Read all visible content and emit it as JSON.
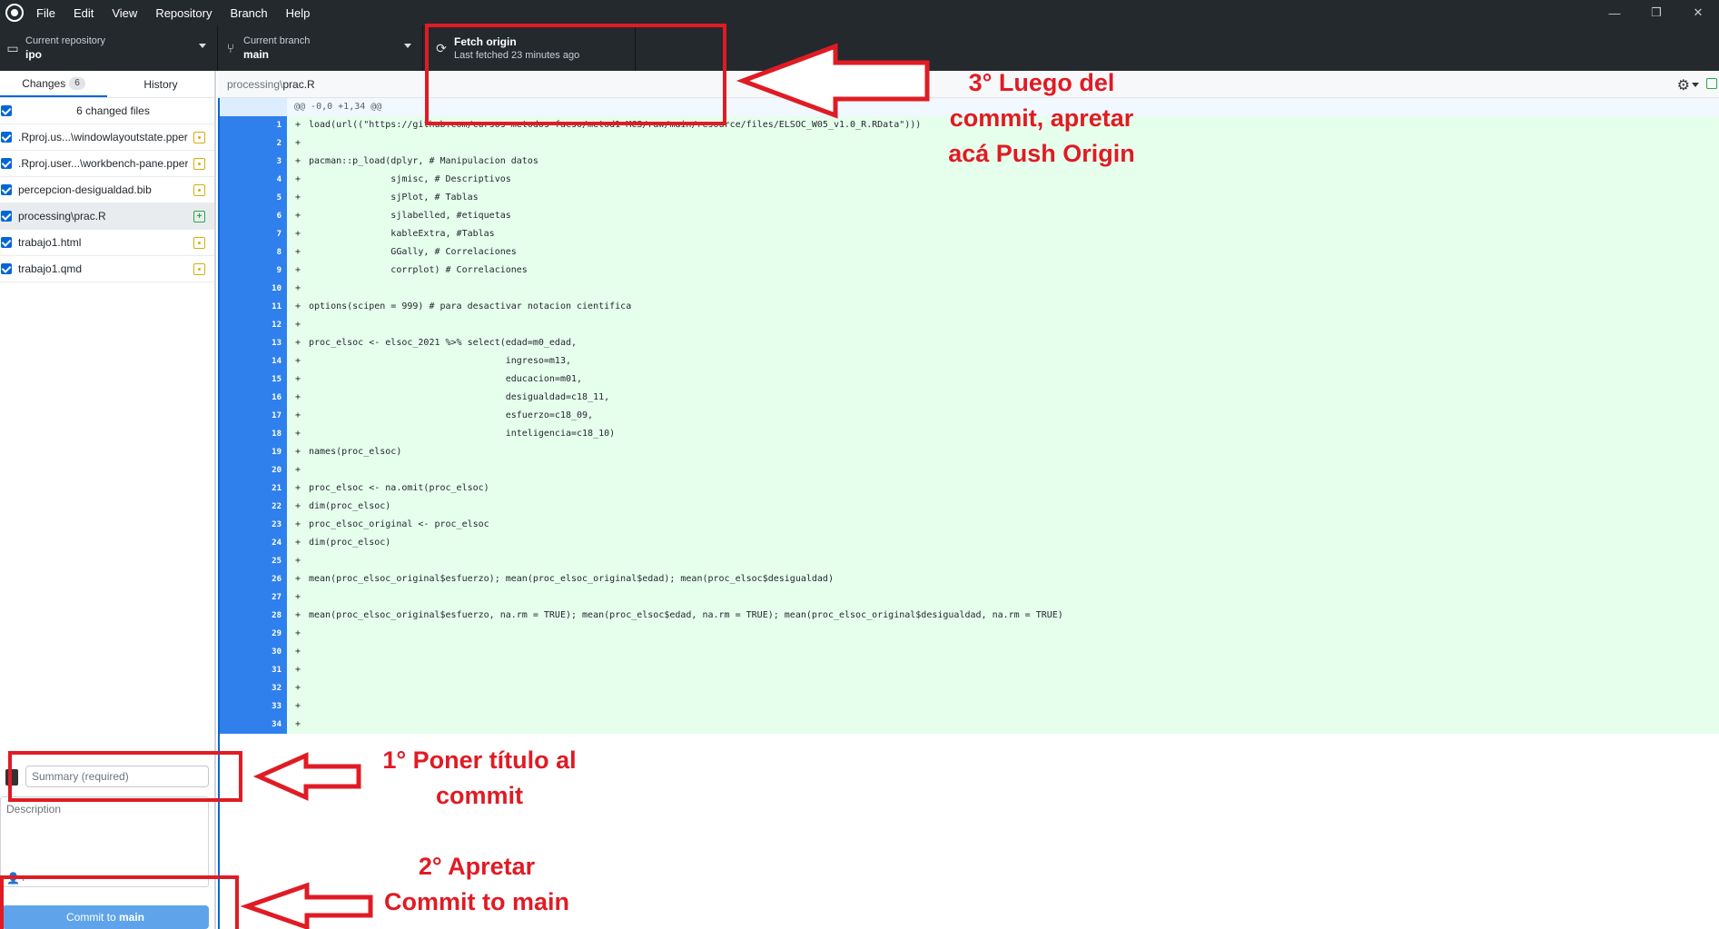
{
  "menubar": {
    "items": [
      "File",
      "Edit",
      "View",
      "Repository",
      "Branch",
      "Help"
    ],
    "minimize": "—",
    "restore": "❐",
    "close": "✕"
  },
  "toolbar": {
    "repo_label": "Current repository",
    "repo_value": "ipo",
    "branch_label": "Current branch",
    "branch_value": "main",
    "fetch_label": "Fetch origin",
    "fetch_status": "Last fetched 23 minutes ago"
  },
  "sidebar": {
    "tabs": [
      {
        "label": "Changes",
        "count": "6"
      },
      {
        "label": "History"
      }
    ],
    "changed_files_header": "6 changed files",
    "files": [
      {
        "name": ".Rproj.us...\\windowlayoutstate.pper",
        "status": "modified"
      },
      {
        "name": ".Rproj.user...\\workbench-pane.pper",
        "status": "modified"
      },
      {
        "name": "percepcion-desigualdad.bib",
        "status": "modified"
      },
      {
        "name": "processing\\prac.R",
        "status": "added"
      },
      {
        "name": "trabajo1.html",
        "status": "modified"
      },
      {
        "name": "trabajo1.qmd",
        "status": "modified"
      }
    ]
  },
  "commit": {
    "summary_placeholder": "Summary (required)",
    "description_placeholder": "Description",
    "button_prefix": "Commit to ",
    "button_branch": "main"
  },
  "diff": {
    "path_dir": "processing\\",
    "path_file": "prac.R",
    "hunk_header": "@@ -0,0 +1,34 @@",
    "marker": "+",
    "lines": [
      "load(url((\"https://github.com/cursos-metodos-facso/metod1-MCS/raw/main/resource/files/ELSOC_W05_v1.0_R.RData\")))",
      "",
      "pacman::p_load(dplyr, # Manipulacion datos",
      "               sjmisc, # Descriptivos",
      "               sjPlot, # Tablas",
      "               sjlabelled, #etiquetas",
      "               kableExtra, #Tablas",
      "               GGally, # Correlaciones",
      "               corrplot) # Correlaciones",
      "",
      "options(scipen = 999) # para desactivar notacion cientifica",
      "",
      "proc_elsoc <- elsoc_2021 %>% select(edad=m0_edad,",
      "                                    ingreso=m13,",
      "                                    educacion=m01,",
      "                                    desigualdad=c18_11,",
      "                                    esfuerzo=c18_09,",
      "                                    inteligencia=c18_10)",
      "names(proc_elsoc)",
      "",
      "proc_elsoc <- na.omit(proc_elsoc)",
      "dim(proc_elsoc)",
      "proc_elsoc_original <- proc_elsoc",
      "dim(proc_elsoc)",
      "",
      "mean(proc_elsoc_original$esfuerzo); mean(proc_elsoc_original$edad); mean(proc_elsoc$desigualdad)",
      "",
      "mean(proc_elsoc_original$esfuerzo, na.rm = TRUE); mean(proc_elsoc$edad, na.rm = TRUE); mean(proc_elsoc_original$desigualdad, na.rm = TRUE)",
      "",
      "",
      "",
      "",
      "",
      ""
    ]
  },
  "annotations": {
    "step1": [
      "1° Poner título al",
      "commit"
    ],
    "step2": [
      "2° Apretar",
      "Commit to main"
    ],
    "step3": [
      "3° Luego del",
      "commit, apretar",
      "acá Push Origin"
    ]
  },
  "colors": {
    "annotation_red": "#e01b24",
    "accent_blue": "#0366d6",
    "added_bg": "#e6ffed",
    "dark_chrome": "#24292e"
  }
}
